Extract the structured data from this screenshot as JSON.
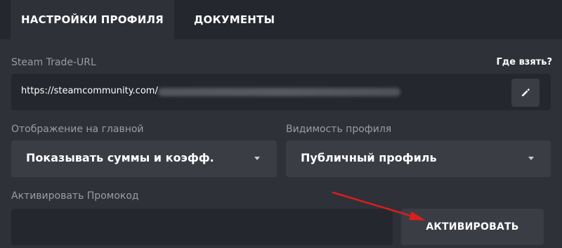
{
  "tabs": [
    {
      "label": "НАСТРОЙКИ ПРОФИЛЯ",
      "active": true
    },
    {
      "label": "ДОКУМЕНТЫ",
      "active": false
    }
  ],
  "trade_url": {
    "label": "Steam Trade-URL",
    "help_link": "Где взять?",
    "value": "https://steamcommunity.com/",
    "edit_icon": "pencil-icon"
  },
  "display": {
    "label": "Отображение на главной",
    "value": "Показывать суммы и коэфф."
  },
  "visibility": {
    "label": "Видимость профиля",
    "value": "Публичный профиль"
  },
  "promo": {
    "label": "Активировать Промокод",
    "value": "",
    "button_label": "АКТИВИРОВАТЬ"
  },
  "colors": {
    "background": "#24272d",
    "panel": "#2e3138",
    "control": "#3a3d44",
    "annotation_arrow": "#d91e1e"
  }
}
